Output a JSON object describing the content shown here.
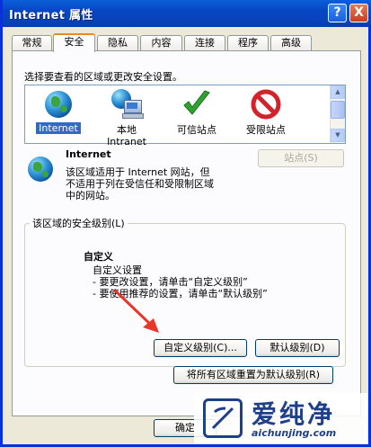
{
  "window": {
    "title": "Internet 属性"
  },
  "titlebar": {
    "help": "?",
    "close": "X"
  },
  "tabs": [
    {
      "label": "常规"
    },
    {
      "label": "安全"
    },
    {
      "label": "隐私"
    },
    {
      "label": "内容"
    },
    {
      "label": "连接"
    },
    {
      "label": "程序"
    },
    {
      "label": "高级"
    }
  ],
  "security": {
    "zones_prompt": "选择要查看的区域或更改安全设置。",
    "zones": [
      {
        "label": "Internet",
        "icon": "globe-icon"
      },
      {
        "label": "本地",
        "label2": "Intranet",
        "icon": "network-icon"
      },
      {
        "label": "可信站点",
        "icon": "checkmark-icon"
      },
      {
        "label": "受限站点",
        "icon": "no-entry-icon"
      }
    ],
    "selected_zone": {
      "name": "Internet",
      "desc_line1": "该区域适用于 Internet 网站，但",
      "desc_line2": "不适用于列在受信任和受限制区域",
      "desc_line3": "中的网站。"
    },
    "sites_button": "站点(S)",
    "level_group": "该区域的安全级别(L)",
    "level": {
      "title": "自定义",
      "line1": "自定义设置",
      "line2": "- 要更改设置，请单击“自定义级别”",
      "line3": "- 要使用推荐的设置，请单击“默认级别”"
    },
    "custom_level_button": "自定义级别(C)...",
    "default_level_button": "默认级别(D)",
    "reset_all_button": "将所有区域重置为默认级别(R)"
  },
  "footer": {
    "ok_button": "确定"
  },
  "watermark": {
    "text": "爱纯净",
    "url": "aichunjing.com"
  },
  "colors": {
    "titlebar": "#0842B8",
    "selection": "#316AC5",
    "arrow": "#E8362A"
  }
}
